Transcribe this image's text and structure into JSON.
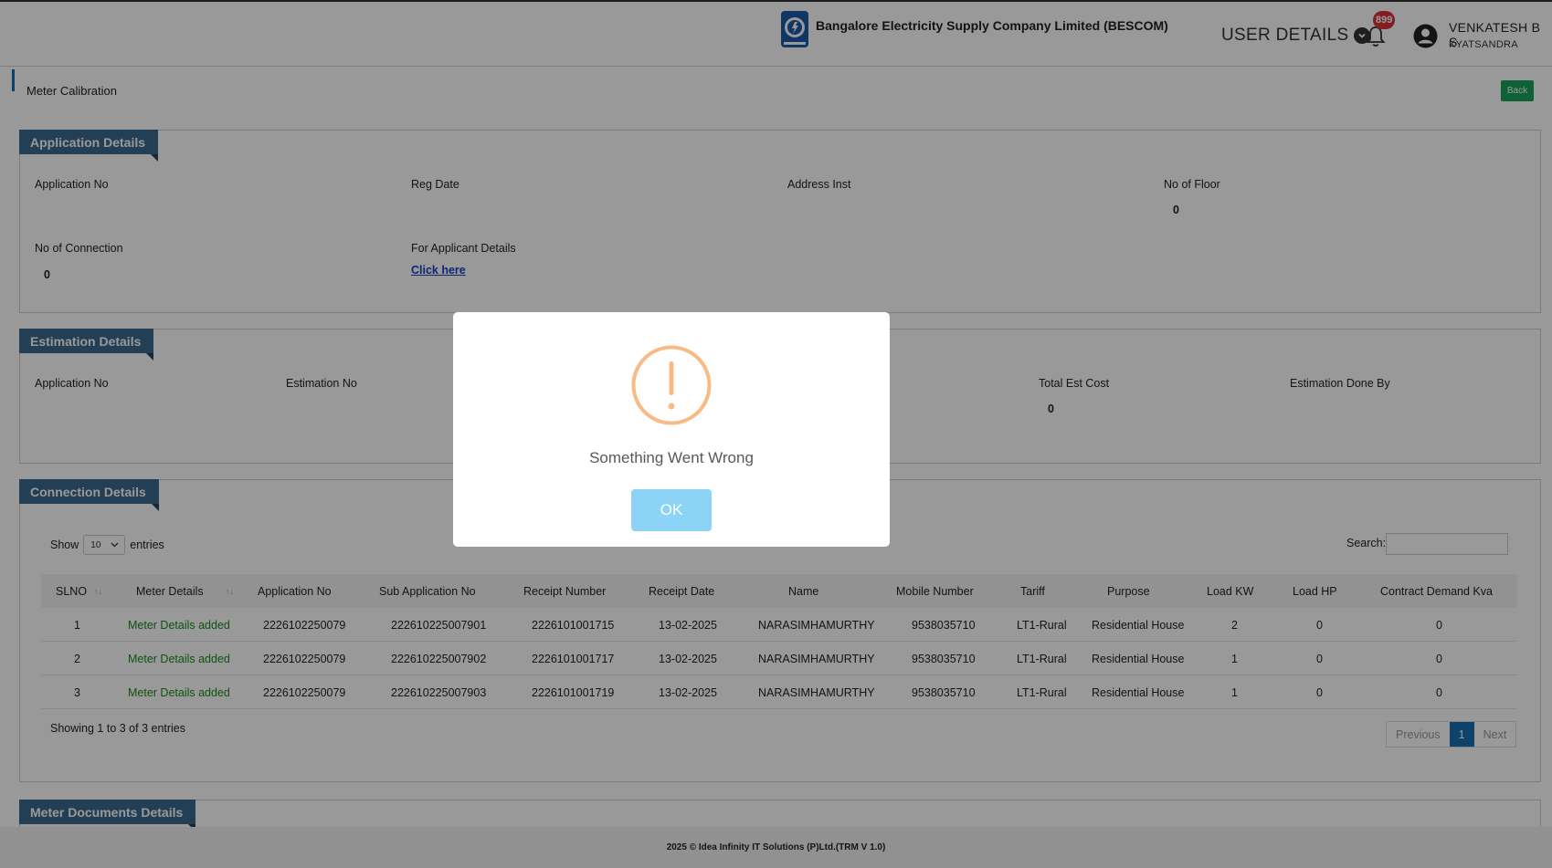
{
  "header": {
    "company": "Bangalore Electricity Supply Company Limited (BESCOM)",
    "user_details_label": "USER DETAILS",
    "notification_count": "899",
    "user_name": "VENKATESH B S",
    "user_location": "KYATSANDRA"
  },
  "page": {
    "title": "Meter Calibration",
    "back_label": "Back"
  },
  "application": {
    "section_title": "Application Details",
    "app_no_label": "Application No",
    "reg_date_label": "Reg Date",
    "address_label": "Address Inst",
    "floor_label": "No of Floor",
    "floor_value": "0",
    "conn_label": "No of Connection",
    "conn_value": "0",
    "applicant_label": "For Applicant Details",
    "applicant_link": "Click here"
  },
  "estimation": {
    "section_title": "Estimation Details",
    "app_no_label": "Application No",
    "est_no_label": "Estimation No",
    "total_label": "Total Est Cost",
    "total_value": "0",
    "done_by_label": "Estimation Done By"
  },
  "connection": {
    "section_title": "Connection Details",
    "show_label": "Show",
    "page_size": "10",
    "entries_label": "entries",
    "search_label": "Search:",
    "columns": [
      "SLNO",
      "Meter Details",
      "Application No",
      "Sub Application No",
      "Receipt Number",
      "Receipt Date",
      "Name",
      "Mobile Number",
      "Tariff",
      "Purpose",
      "Load KW",
      "Load HP",
      "Contract Demand Kva"
    ],
    "rows": [
      [
        "1",
        "Meter Details added",
        "2226102250079",
        "222610225007901",
        "2226101001715",
        "13-02-2025",
        "NARASIMHAMURTHY",
        "9538035710",
        "LT1-Rural",
        "Residential House",
        "2",
        "0",
        "0"
      ],
      [
        "2",
        "Meter Details added",
        "2226102250079",
        "222610225007902",
        "2226101001717",
        "13-02-2025",
        "NARASIMHAMURTHY",
        "9538035710",
        "LT1-Rural",
        "Residential House",
        "1",
        "0",
        "0"
      ],
      [
        "3",
        "Meter Details added",
        "2226102250079",
        "222610225007903",
        "2226101001719",
        "13-02-2025",
        "NARASIMHAMURTHY",
        "9538035710",
        "LT1-Rural",
        "Residential House",
        "1",
        "0",
        "0"
      ]
    ],
    "info": "Showing 1 to 3 of 3 entries",
    "pager": {
      "prev": "Previous",
      "current": "1",
      "next": "Next"
    }
  },
  "documents": {
    "section_title": "Meter Documents Details"
  },
  "footer": {
    "text": "2025 © Idea Infinity IT Solutions (P)Ltd.(TRM V 1.0)"
  },
  "modal": {
    "message": "Something Went Wrong",
    "ok_label": "OK"
  },
  "colors": {
    "section_tab": "#3b6a8f",
    "back_button": "#1aa35a",
    "ok_button": "#8cd4f5",
    "warning": "#f8bb86"
  },
  "icons": [
    "bescom-logo-icon",
    "chevron-down-circle-icon",
    "bell-icon",
    "user-avatar-icon",
    "warning-icon"
  ]
}
